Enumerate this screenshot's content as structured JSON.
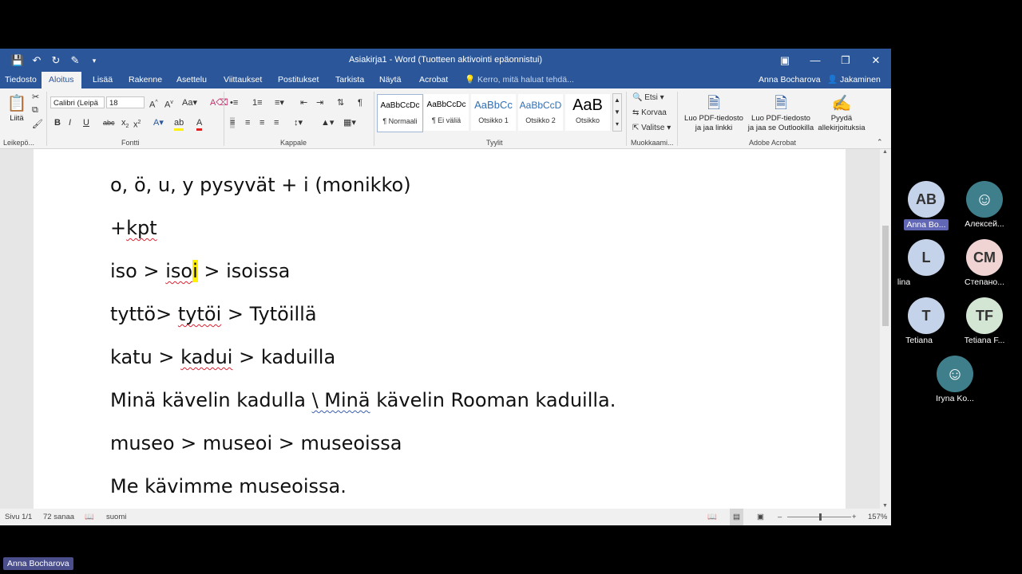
{
  "window": {
    "title": "Asiakirja1 - Word (Tuotteen aktivointi epäonnistui)",
    "qat": [
      "save-icon",
      "undo-icon",
      "redo-icon",
      "touch-icon"
    ]
  },
  "tabs": [
    "Tiedosto",
    "Aloitus",
    "Lisää",
    "Rakenne",
    "Asettelu",
    "Viittaukset",
    "Postitukset",
    "Tarkista",
    "Näytä",
    "Acrobat"
  ],
  "tell_me": "Kerro, mitä haluat tehdä...",
  "user": "Anna Bocharova",
  "share": "Jakaminen",
  "ribbon": {
    "paste": "Liitä",
    "font_name": "Calibri (Leipä",
    "font_size": "18",
    "styles": [
      {
        "sample": "AaBbCcDc",
        "name": "¶ Normaali"
      },
      {
        "sample": "AaBbCcDc",
        "name": "¶ Ei väliä"
      },
      {
        "sample": "AaBbCc",
        "name": "Otsikko 1"
      },
      {
        "sample": "AaBbCcD",
        "name": "Otsikko 2"
      },
      {
        "sample": "AaB",
        "name": "Otsikko"
      }
    ],
    "edit": {
      "find": "Etsi",
      "replace": "Korvaa",
      "select": "Valitse"
    },
    "acrobat": {
      "pdf_link": [
        "Luo PDF-tiedosto",
        "ja jaa linkki"
      ],
      "pdf_outlook": [
        "Luo PDF-tiedosto",
        "ja jaa se Outlookilla"
      ],
      "signatures": [
        "Pyydä",
        "allekirjoituksia"
      ]
    },
    "groups": [
      "Leikepö...",
      "Fontti",
      "Kappale",
      "Tyylit",
      "Muokkaami...",
      "Adobe Acrobat"
    ]
  },
  "document": {
    "lines": {
      "l0": "o, ö, u, y    pysyvät   + i (monikko)",
      "l1a": "+",
      "l1b": "kpt",
      "l2a": "iso > ",
      "l2b": "iso",
      "l2c": "i",
      "l2d": " > isoissa",
      "l3a": "tyttö> ",
      "l3b": "tytöi",
      "l3c": " > Tytöillä",
      "l4a": "katu > ",
      "l4b": "kadui",
      "l4c": " > kaduilla",
      "l5a": "Minä kävelin kadulla ",
      "l5b": "\\  Minä",
      "l5c": " kävelin Rooman kaduilla.",
      "l6": "museo > museoi > museoissa",
      "l7": "Me kävimme museoissa."
    }
  },
  "status": {
    "page": "Sivu 1/1",
    "words": "72 sanaa",
    "language": "suomi",
    "zoom": "157%"
  },
  "participants": [
    {
      "initials": "AB",
      "name": "Anna Bo...",
      "color": "#c5d3ea",
      "active": true
    },
    {
      "initials": "",
      "name": "Алексей...",
      "color": "#3f7f8c",
      "icon": "person-icon"
    },
    {
      "initials": "L",
      "name": "lina",
      "color": "#c5d3ea"
    },
    {
      "initials": "CM",
      "name": "Степано...",
      "color": "#f0d3d3"
    },
    {
      "initials": "T",
      "name": "Tetiana",
      "color": "#c5d3ea"
    },
    {
      "initials": "TF",
      "name": "Tetiana F...",
      "color": "#d3e6d3"
    },
    {
      "initials": "",
      "name": "Iryna Ko...",
      "color": "#3f7f8c",
      "icon": "person-icon"
    }
  ],
  "presenter": "Anna Bocharova"
}
